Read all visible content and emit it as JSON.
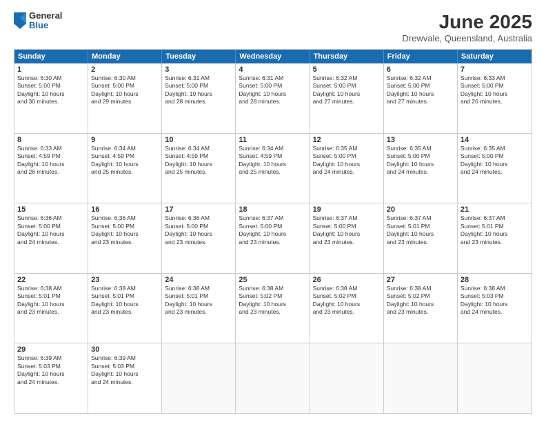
{
  "header": {
    "logo_general": "General",
    "logo_blue": "Blue",
    "month_title": "June 2025",
    "location": "Drewvale, Queensland, Australia"
  },
  "days_of_week": [
    "Sunday",
    "Monday",
    "Tuesday",
    "Wednesday",
    "Thursday",
    "Friday",
    "Saturday"
  ],
  "weeks": [
    [
      {
        "num": "1",
        "info": "Sunrise: 6:30 AM\nSunset: 5:00 PM\nDaylight: 10 hours\nand 30 minutes."
      },
      {
        "num": "2",
        "info": "Sunrise: 6:30 AM\nSunset: 5:00 PM\nDaylight: 10 hours\nand 29 minutes."
      },
      {
        "num": "3",
        "info": "Sunrise: 6:31 AM\nSunset: 5:00 PM\nDaylight: 10 hours\nand 28 minutes."
      },
      {
        "num": "4",
        "info": "Sunrise: 6:31 AM\nSunset: 5:00 PM\nDaylight: 10 hours\nand 28 minutes."
      },
      {
        "num": "5",
        "info": "Sunrise: 6:32 AM\nSunset: 5:00 PM\nDaylight: 10 hours\nand 27 minutes."
      },
      {
        "num": "6",
        "info": "Sunrise: 6:32 AM\nSunset: 5:00 PM\nDaylight: 10 hours\nand 27 minutes."
      },
      {
        "num": "7",
        "info": "Sunrise: 6:33 AM\nSunset: 5:00 PM\nDaylight: 10 hours\nand 26 minutes."
      }
    ],
    [
      {
        "num": "8",
        "info": "Sunrise: 6:33 AM\nSunset: 4:59 PM\nDaylight: 10 hours\nand 26 minutes."
      },
      {
        "num": "9",
        "info": "Sunrise: 6:34 AM\nSunset: 4:59 PM\nDaylight: 10 hours\nand 25 minutes."
      },
      {
        "num": "10",
        "info": "Sunrise: 6:34 AM\nSunset: 4:59 PM\nDaylight: 10 hours\nand 25 minutes."
      },
      {
        "num": "11",
        "info": "Sunrise: 6:34 AM\nSunset: 4:59 PM\nDaylight: 10 hours\nand 25 minutes."
      },
      {
        "num": "12",
        "info": "Sunrise: 6:35 AM\nSunset: 5:00 PM\nDaylight: 10 hours\nand 24 minutes."
      },
      {
        "num": "13",
        "info": "Sunrise: 6:35 AM\nSunset: 5:00 PM\nDaylight: 10 hours\nand 24 minutes."
      },
      {
        "num": "14",
        "info": "Sunrise: 6:35 AM\nSunset: 5:00 PM\nDaylight: 10 hours\nand 24 minutes."
      }
    ],
    [
      {
        "num": "15",
        "info": "Sunrise: 6:36 AM\nSunset: 5:00 PM\nDaylight: 10 hours\nand 24 minutes."
      },
      {
        "num": "16",
        "info": "Sunrise: 6:36 AM\nSunset: 5:00 PM\nDaylight: 10 hours\nand 23 minutes."
      },
      {
        "num": "17",
        "info": "Sunrise: 6:36 AM\nSunset: 5:00 PM\nDaylight: 10 hours\nand 23 minutes."
      },
      {
        "num": "18",
        "info": "Sunrise: 6:37 AM\nSunset: 5:00 PM\nDaylight: 10 hours\nand 23 minutes."
      },
      {
        "num": "19",
        "info": "Sunrise: 6:37 AM\nSunset: 5:00 PM\nDaylight: 10 hours\nand 23 minutes."
      },
      {
        "num": "20",
        "info": "Sunrise: 6:37 AM\nSunset: 5:01 PM\nDaylight: 10 hours\nand 23 minutes."
      },
      {
        "num": "21",
        "info": "Sunrise: 6:37 AM\nSunset: 5:01 PM\nDaylight: 10 hours\nand 23 minutes."
      }
    ],
    [
      {
        "num": "22",
        "info": "Sunrise: 6:38 AM\nSunset: 5:01 PM\nDaylight: 10 hours\nand 23 minutes."
      },
      {
        "num": "23",
        "info": "Sunrise: 6:38 AM\nSunset: 5:01 PM\nDaylight: 10 hours\nand 23 minutes."
      },
      {
        "num": "24",
        "info": "Sunrise: 6:38 AM\nSunset: 5:01 PM\nDaylight: 10 hours\nand 23 minutes."
      },
      {
        "num": "25",
        "info": "Sunrise: 6:38 AM\nSunset: 5:02 PM\nDaylight: 10 hours\nand 23 minutes."
      },
      {
        "num": "26",
        "info": "Sunrise: 6:38 AM\nSunset: 5:02 PM\nDaylight: 10 hours\nand 23 minutes."
      },
      {
        "num": "27",
        "info": "Sunrise: 6:38 AM\nSunset: 5:02 PM\nDaylight: 10 hours\nand 23 minutes."
      },
      {
        "num": "28",
        "info": "Sunrise: 6:38 AM\nSunset: 5:03 PM\nDaylight: 10 hours\nand 24 minutes."
      }
    ],
    [
      {
        "num": "29",
        "info": "Sunrise: 6:39 AM\nSunset: 5:03 PM\nDaylight: 10 hours\nand 24 minutes."
      },
      {
        "num": "30",
        "info": "Sunrise: 6:39 AM\nSunset: 5:03 PM\nDaylight: 10 hours\nand 24 minutes."
      },
      {
        "num": "",
        "info": ""
      },
      {
        "num": "",
        "info": ""
      },
      {
        "num": "",
        "info": ""
      },
      {
        "num": "",
        "info": ""
      },
      {
        "num": "",
        "info": ""
      }
    ]
  ]
}
